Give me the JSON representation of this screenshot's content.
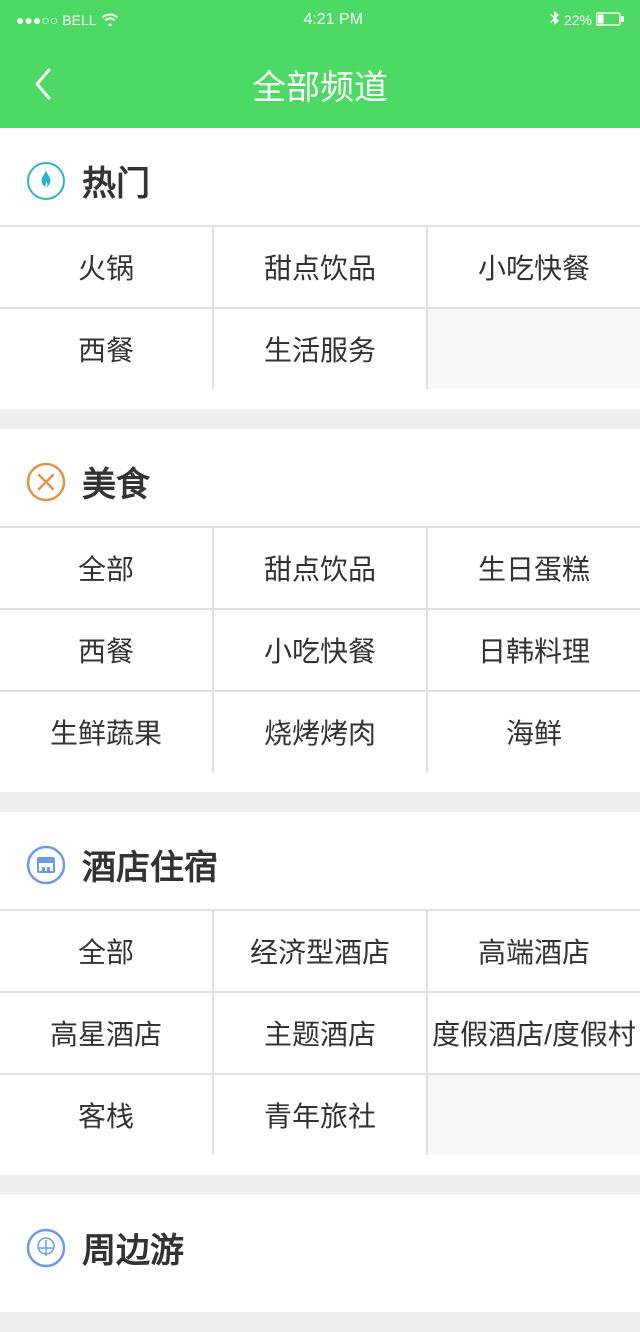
{
  "statusBar": {
    "signal": "●●●○○",
    "carrier": "BELL",
    "time": "4:21 PM",
    "bluetooth": "bluetooth",
    "battery": "22%"
  },
  "navBar": {
    "backLabel": "‹",
    "title": "全部频道"
  },
  "sections": [
    {
      "id": "hot",
      "title": "热门",
      "iconType": "flame",
      "items": [
        [
          "火锅",
          "甜点饮品",
          "小吃快餐"
        ],
        [
          "西餐",
          "生活服务",
          ""
        ]
      ]
    },
    {
      "id": "food",
      "title": "美食",
      "iconType": "fork",
      "items": [
        [
          "全部",
          "甜点饮品",
          "生日蛋糕"
        ],
        [
          "西餐",
          "小吃快餐",
          "日韩料理"
        ],
        [
          "生鲜蔬果",
          "烧烤烤肉",
          "海鲜"
        ]
      ]
    },
    {
      "id": "hotel",
      "title": "酒店住宿",
      "iconType": "hotel",
      "items": [
        [
          "全部",
          "经济型酒店",
          "高端酒店"
        ],
        [
          "高星酒店",
          "主题酒店",
          "度假酒店/度假村"
        ],
        [
          "客栈",
          "青年旅社",
          ""
        ]
      ]
    },
    {
      "id": "tour",
      "title": "周边游",
      "iconType": "tour",
      "items": []
    }
  ]
}
